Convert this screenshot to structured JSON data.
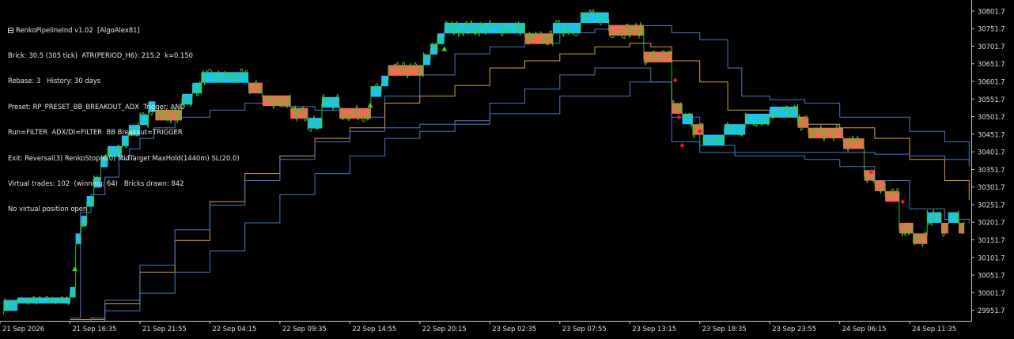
{
  "indicator": {
    "name": "RenkoPipelineInd v1.02",
    "author": "[AlgoAlex81]",
    "lines": [
      "Brick: 30.5 (305 tick)  ATR(PERIOD_H6): 215.2  k=0.150",
      "Rebase: 3   History: 30 days",
      "Preset: RP_PRESET_BB_BREAKOUT_ADX  Trigger: AND",
      "Run=FILTER  ADX/DI=FILTER  BB Breakout=TRIGGER",
      "Exit: Reversal(3) RenkoStop(6.0) MidTarget MaxHold(1440m) SL(20.0)",
      "Virtual trades: 102  (winning: 64)   Bricks drawn: 842",
      "No virtual position open"
    ]
  },
  "colors": {
    "background": "#000000",
    "up_brick": "#1cc4f5",
    "down_brick": "#f06a55",
    "price": "#3ecf1f",
    "bb_band": "#4a78c8",
    "bb_mid": "#d7a53a",
    "signal_up": "#35e02a",
    "signal_down": "#e81c1c",
    "axis": "#c8c8c8"
  },
  "chart_data": {
    "type": "line",
    "title": "",
    "ylim": [
      29921.7,
      30821.7
    ],
    "y_ticks": [
      "30801.7",
      "30751.7",
      "30701.7",
      "30651.7",
      "30601.7",
      "30551.7",
      "30501.7",
      "30451.7",
      "30401.7",
      "30351.7",
      "30301.7",
      "30251.7",
      "30201.7",
      "30151.7",
      "30101.7",
      "30051.7",
      "30001.7",
      "29951.7"
    ],
    "x_ticks": [
      "21 Sep 2026",
      "21 Sep 16:35",
      "21 Sep 21:55",
      "22 Sep 04:15",
      "22 Sep 09:35",
      "22 Sep 14:55",
      "22 Sep 20:15",
      "23 Sep 02:35",
      "23 Sep 07:55",
      "23 Sep 13:15",
      "23 Sep 18:35",
      "23 Sep 23:55",
      "24 Sep 06:15",
      "24 Sep 11:35"
    ],
    "x_range": [
      0,
      13.88
    ],
    "renko_bricks": [
      {
        "x0": 0.05,
        "x1": 0.25,
        "lo": 29950,
        "hi": 29981,
        "dir": "up"
      },
      {
        "x0": 0.25,
        "x1": 1.0,
        "lo": 29971,
        "hi": 29988,
        "dir": "up"
      },
      {
        "x0": 1.0,
        "x1": 1.08,
        "lo": 29988,
        "hi": 30018,
        "dir": "up"
      },
      {
        "x0": 1.08,
        "x1": 1.16,
        "lo": 30140,
        "hi": 30170,
        "dir": "up"
      },
      {
        "x0": 1.16,
        "x1": 1.24,
        "lo": 30190,
        "hi": 30220,
        "dir": "up"
      },
      {
        "x0": 1.24,
        "x1": 1.34,
        "lo": 30246,
        "hi": 30276,
        "dir": "up"
      },
      {
        "x0": 1.34,
        "x1": 1.44,
        "lo": 30300,
        "hi": 30330,
        "dir": "up"
      },
      {
        "x0": 1.44,
        "x1": 1.54,
        "lo": 30358,
        "hi": 30388,
        "dir": "up"
      },
      {
        "x0": 1.54,
        "x1": 1.74,
        "lo": 30388,
        "hi": 30418,
        "dir": "up"
      },
      {
        "x0": 1.74,
        "x1": 1.84,
        "lo": 30418,
        "hi": 30448,
        "dir": "up"
      },
      {
        "x0": 1.84,
        "x1": 2.0,
        "lo": 30448,
        "hi": 30478,
        "dir": "up"
      },
      {
        "x0": 2.0,
        "x1": 2.12,
        "lo": 30478,
        "hi": 30508,
        "dir": "up"
      },
      {
        "x0": 2.12,
        "x1": 2.22,
        "lo": 30515,
        "hi": 30545,
        "dir": "up"
      },
      {
        "x0": 2.22,
        "x1": 2.6,
        "lo": 30491,
        "hi": 30521,
        "dir": "down"
      },
      {
        "x0": 2.6,
        "x1": 2.75,
        "lo": 30536,
        "hi": 30566,
        "dir": "up"
      },
      {
        "x0": 2.75,
        "x1": 2.88,
        "lo": 30568,
        "hi": 30598,
        "dir": "up"
      },
      {
        "x0": 2.88,
        "x1": 3.55,
        "lo": 30598,
        "hi": 30628,
        "dir": "up"
      },
      {
        "x0": 3.55,
        "x1": 3.75,
        "lo": 30568,
        "hi": 30598,
        "dir": "down"
      },
      {
        "x0": 3.75,
        "x1": 4.15,
        "lo": 30532,
        "hi": 30562,
        "dir": "down"
      },
      {
        "x0": 4.15,
        "x1": 4.4,
        "lo": 30496,
        "hi": 30526,
        "dir": "down"
      },
      {
        "x0": 4.4,
        "x1": 4.6,
        "lo": 30468,
        "hi": 30498,
        "dir": "up"
      },
      {
        "x0": 4.6,
        "x1": 4.85,
        "lo": 30527,
        "hi": 30557,
        "dir": "up"
      },
      {
        "x0": 4.85,
        "x1": 5.3,
        "lo": 30496,
        "hi": 30526,
        "dir": "down"
      },
      {
        "x0": 5.3,
        "x1": 5.45,
        "lo": 30558,
        "hi": 30588,
        "dir": "up"
      },
      {
        "x0": 5.45,
        "x1": 5.55,
        "lo": 30588,
        "hi": 30618,
        "dir": "up"
      },
      {
        "x0": 5.55,
        "x1": 6.05,
        "lo": 30618,
        "hi": 30648,
        "dir": "down"
      },
      {
        "x0": 6.05,
        "x1": 6.15,
        "lo": 30648,
        "hi": 30678,
        "dir": "up"
      },
      {
        "x0": 6.15,
        "x1": 6.25,
        "lo": 30678,
        "hi": 30708,
        "dir": "up"
      },
      {
        "x0": 6.25,
        "x1": 6.35,
        "lo": 30708,
        "hi": 30738,
        "dir": "up"
      },
      {
        "x0": 6.35,
        "x1": 7.5,
        "lo": 30738,
        "hi": 30768,
        "dir": "up"
      },
      {
        "x0": 7.5,
        "x1": 7.9,
        "lo": 30708,
        "hi": 30738,
        "dir": "down"
      },
      {
        "x0": 7.9,
        "x1": 8.3,
        "lo": 30738,
        "hi": 30768,
        "dir": "up"
      },
      {
        "x0": 8.3,
        "x1": 8.7,
        "lo": 30768,
        "hi": 30798,
        "dir": "up"
      },
      {
        "x0": 8.7,
        "x1": 9.2,
        "lo": 30732,
        "hi": 30762,
        "dir": "down"
      },
      {
        "x0": 9.2,
        "x1": 9.6,
        "lo": 30656,
        "hi": 30686,
        "dir": "down"
      },
      {
        "x0": 9.6,
        "x1": 9.75,
        "lo": 30510,
        "hi": 30540,
        "dir": "down"
      },
      {
        "x0": 9.75,
        "x1": 9.9,
        "lo": 30480,
        "hi": 30510,
        "dir": "up"
      },
      {
        "x0": 9.9,
        "x1": 10.05,
        "lo": 30450,
        "hi": 30480,
        "dir": "down"
      },
      {
        "x0": 10.05,
        "x1": 10.35,
        "lo": 30420,
        "hi": 30450,
        "dir": "up"
      },
      {
        "x0": 10.35,
        "x1": 10.65,
        "lo": 30450,
        "hi": 30480,
        "dir": "up"
      },
      {
        "x0": 10.65,
        "x1": 11.0,
        "lo": 30480,
        "hi": 30510,
        "dir": "up"
      },
      {
        "x0": 11.0,
        "x1": 11.4,
        "lo": 30500,
        "hi": 30530,
        "dir": "up"
      },
      {
        "x0": 11.4,
        "x1": 11.55,
        "lo": 30470,
        "hi": 30500,
        "dir": "down"
      },
      {
        "x0": 11.55,
        "x1": 12.05,
        "lo": 30440,
        "hi": 30470,
        "dir": "down"
      },
      {
        "x0": 12.05,
        "x1": 12.35,
        "lo": 30410,
        "hi": 30440,
        "dir": "down"
      },
      {
        "x0": 12.35,
        "x1": 12.5,
        "lo": 30320,
        "hi": 30350,
        "dir": "down"
      },
      {
        "x0": 12.5,
        "x1": 12.65,
        "lo": 30290,
        "hi": 30320,
        "dir": "down"
      },
      {
        "x0": 12.65,
        "x1": 12.85,
        "lo": 30260,
        "hi": 30290,
        "dir": "down"
      },
      {
        "x0": 12.85,
        "x1": 13.05,
        "lo": 30170,
        "hi": 30200,
        "dir": "down"
      },
      {
        "x0": 13.05,
        "x1": 13.25,
        "lo": 30140,
        "hi": 30170,
        "dir": "down"
      },
      {
        "x0": 13.25,
        "x1": 13.45,
        "lo": 30200,
        "hi": 30230,
        "dir": "up"
      },
      {
        "x0": 13.45,
        "x1": 13.55,
        "lo": 30170,
        "hi": 30200,
        "dir": "down"
      },
      {
        "x0": 13.55,
        "x1": 13.7,
        "lo": 30200,
        "hi": 30230,
        "dir": "up"
      },
      {
        "x0": 13.7,
        "x1": 13.78,
        "lo": 30170,
        "hi": 30200,
        "dir": "down"
      }
    ],
    "series": [
      {
        "role": "upper_band",
        "points": [
          [
            1.0,
            29930
          ],
          [
            1.15,
            30230
          ],
          [
            1.3,
            30280
          ],
          [
            1.5,
            30330
          ],
          [
            1.7,
            30380
          ],
          [
            1.85,
            30410
          ],
          [
            2.0,
            30440
          ],
          [
            2.2,
            30470
          ],
          [
            2.5,
            30500
          ],
          [
            3.0,
            30520
          ],
          [
            3.5,
            30540
          ],
          [
            4.0,
            30530
          ],
          [
            4.5,
            30520
          ],
          [
            5.0,
            30500
          ],
          [
            5.5,
            30560
          ],
          [
            6.0,
            30620
          ],
          [
            6.5,
            30680
          ],
          [
            7.0,
            30700
          ],
          [
            7.5,
            30710
          ],
          [
            8.0,
            30740
          ],
          [
            8.5,
            30750
          ],
          [
            9.0,
            30760
          ],
          [
            9.3,
            30760
          ],
          [
            9.6,
            30740
          ],
          [
            10.0,
            30720
          ],
          [
            10.4,
            30640
          ],
          [
            10.6,
            30560
          ],
          [
            11.0,
            30550
          ],
          [
            11.5,
            30540
          ],
          [
            12.0,
            30500
          ],
          [
            12.5,
            30500
          ],
          [
            13.0,
            30460
          ],
          [
            13.5,
            30430
          ],
          [
            13.85,
            30360
          ]
        ]
      },
      {
        "role": "middle_band",
        "points": [
          [
            1.0,
            29925
          ],
          [
            1.5,
            29970
          ],
          [
            2.0,
            30060
          ],
          [
            2.5,
            30150
          ],
          [
            3.0,
            30260
          ],
          [
            3.5,
            30340
          ],
          [
            4.0,
            30390
          ],
          [
            4.5,
            30440
          ],
          [
            5.0,
            30470
          ],
          [
            5.5,
            30540
          ],
          [
            6.0,
            30560
          ],
          [
            6.5,
            30590
          ],
          [
            7.0,
            30640
          ],
          [
            7.5,
            30660
          ],
          [
            8.0,
            30680
          ],
          [
            8.5,
            30700
          ],
          [
            9.0,
            30710
          ],
          [
            9.3,
            30700
          ],
          [
            9.6,
            30660
          ],
          [
            10.0,
            30600
          ],
          [
            10.4,
            30520
          ],
          [
            11.0,
            30500
          ],
          [
            11.5,
            30480
          ],
          [
            12.0,
            30470
          ],
          [
            12.5,
            30440
          ],
          [
            13.0,
            30380
          ],
          [
            13.5,
            30320
          ],
          [
            13.85,
            30265
          ]
        ]
      },
      {
        "role": "lower_band",
        "points": [
          [
            1.0,
            29920
          ],
          [
            1.3,
            29930
          ],
          [
            1.5,
            29950
          ],
          [
            2.0,
            30000
          ],
          [
            2.5,
            30060
          ],
          [
            3.0,
            30120
          ],
          [
            3.5,
            30200
          ],
          [
            4.0,
            30280
          ],
          [
            4.5,
            30340
          ],
          [
            5.0,
            30390
          ],
          [
            5.5,
            30440
          ],
          [
            6.0,
            30460
          ],
          [
            6.5,
            30490
          ],
          [
            7.0,
            30540
          ],
          [
            7.5,
            30580
          ],
          [
            8.0,
            30620
          ],
          [
            8.5,
            30640
          ],
          [
            9.0,
            30640
          ],
          [
            9.3,
            30600
          ],
          [
            9.6,
            30500
          ],
          [
            10.0,
            30420
          ],
          [
            10.5,
            30400
          ],
          [
            11.0,
            30400
          ],
          [
            12.0,
            30400
          ],
          [
            12.5,
            30395
          ],
          [
            13.0,
            30390
          ],
          [
            13.5,
            30380
          ],
          [
            13.85,
            30370
          ]
        ]
      },
      {
        "role": "lower_band_2",
        "points": [
          [
            1.2,
            29920
          ],
          [
            1.5,
            29980
          ],
          [
            2.0,
            30080
          ],
          [
            2.5,
            30180
          ],
          [
            3.0,
            30250
          ],
          [
            3.5,
            30320
          ],
          [
            4.0,
            30380
          ],
          [
            4.5,
            30430
          ],
          [
            5.0,
            30460
          ],
          [
            5.5,
            30470
          ],
          [
            6.0,
            30480
          ],
          [
            7.0,
            30510
          ],
          [
            8.0,
            30560
          ],
          [
            9.0,
            30600
          ],
          [
            9.3,
            30600
          ],
          [
            9.6,
            30430
          ],
          [
            10.0,
            30400
          ],
          [
            10.5,
            30390
          ],
          [
            11.0,
            30390
          ],
          [
            11.5,
            30380
          ],
          [
            12.0,
            30360
          ],
          [
            12.5,
            30320
          ],
          [
            13.0,
            30240
          ],
          [
            13.5,
            30210
          ],
          [
            13.85,
            30200
          ]
        ]
      }
    ],
    "signals_up": [
      [
        1.07,
        30065
      ],
      [
        5.29,
        30530
      ],
      [
        6.35,
        30690
      ]
    ],
    "signals_down": [
      [
        9.65,
        30605
      ],
      [
        9.7,
        30500
      ],
      [
        9.75,
        30420
      ],
      [
        10.0,
        30460
      ],
      [
        12.45,
        30345
      ],
      [
        12.9,
        30260
      ]
    ]
  }
}
